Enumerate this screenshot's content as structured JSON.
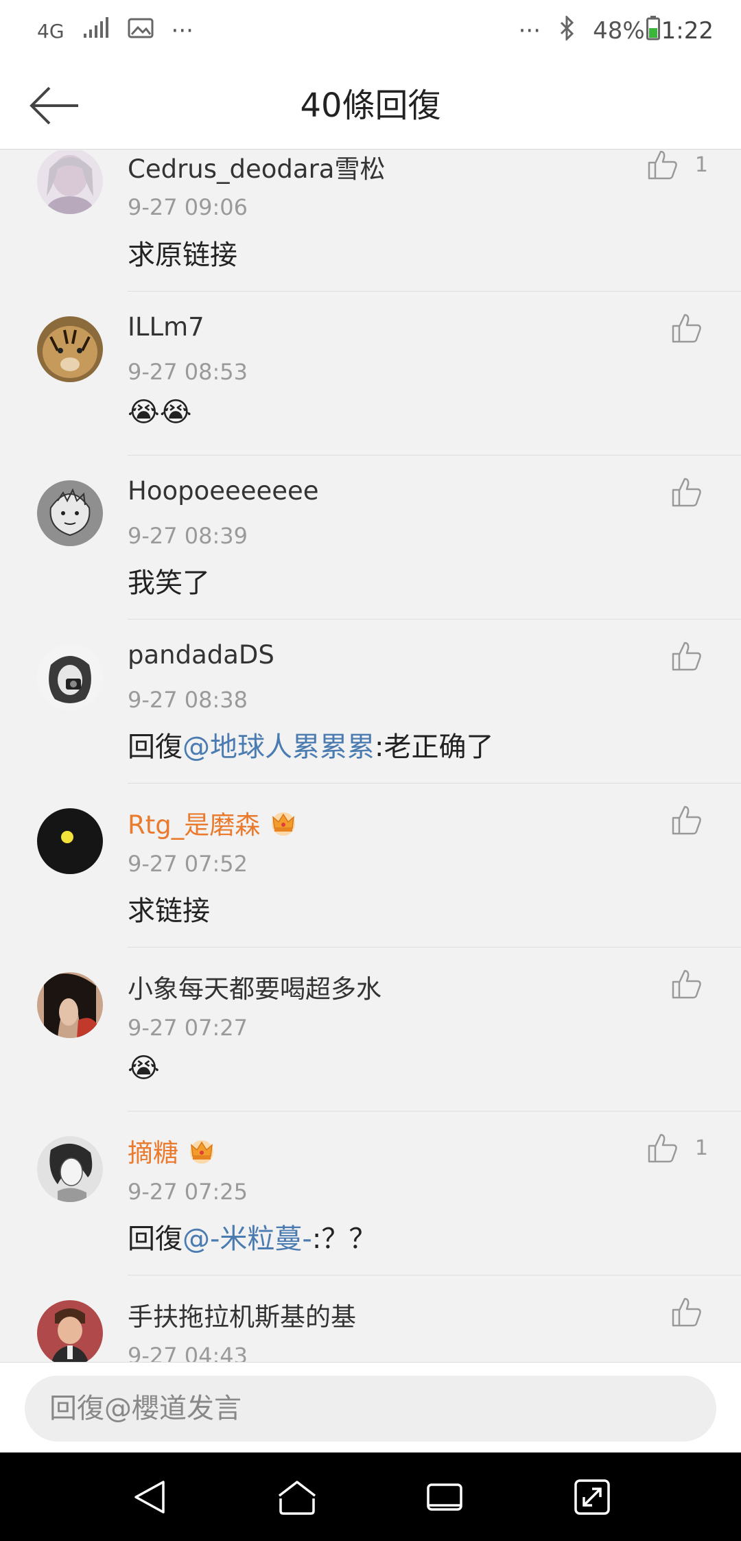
{
  "status_bar": {
    "network": "4G",
    "left_more": "···",
    "right_more": "···",
    "battery": "48%",
    "time": "1:22"
  },
  "header": {
    "title": "40條回復"
  },
  "comments": [
    {
      "username": "Cedrus_deodara雪松",
      "vip": false,
      "timestamp": "9-27 09:06",
      "text": "求原链接",
      "likes": "1",
      "avatar_color": "#c9b6c8"
    },
    {
      "username": "ILLm7",
      "vip": false,
      "timestamp": "9-27 08:53",
      "text": "😭😭",
      "likes": "",
      "avatar_color": "#a07a4a"
    },
    {
      "username": "Hoopoeeeeeee",
      "vip": false,
      "timestamp": "9-27 08:39",
      "text": "我笑了",
      "likes": "",
      "avatar_color": "#9a9a9a"
    },
    {
      "username": "pandadaDS",
      "vip": false,
      "timestamp": "9-27 08:38",
      "reply_prefix": "回復",
      "mention": "@地球人累累累",
      "text": ":老正确了",
      "likes": "",
      "avatar_color": "#d8d8d8"
    },
    {
      "username": "Rtg_是磨森",
      "vip": true,
      "timestamp": "9-27 07:52",
      "text": "求链接",
      "likes": "",
      "avatar_color": "#1a1a1a"
    },
    {
      "username": "小象每天都要喝超多水",
      "vip": false,
      "timestamp": "9-27 07:27",
      "text": "😭",
      "likes": "",
      "avatar_color": "#6b3a2a"
    },
    {
      "username": "摘糖",
      "vip": true,
      "timestamp": "9-27 07:25",
      "reply_prefix": "回復",
      "mention": "@-米粒蔓-",
      "text": ":？？",
      "likes": "1",
      "avatar_color": "#b5b5b5"
    },
    {
      "username": "手扶拖拉机斯基的基",
      "vip": false,
      "timestamp": "9-27 04:43",
      "text": "",
      "likes": "",
      "avatar_color": "#8a4a4a"
    }
  ],
  "reply_bar": {
    "placeholder": "回復@櫻道发言"
  },
  "colors": {
    "vip_name": "#ea7a2d",
    "mention": "#4a7bb1",
    "like_icon": "#999999"
  }
}
